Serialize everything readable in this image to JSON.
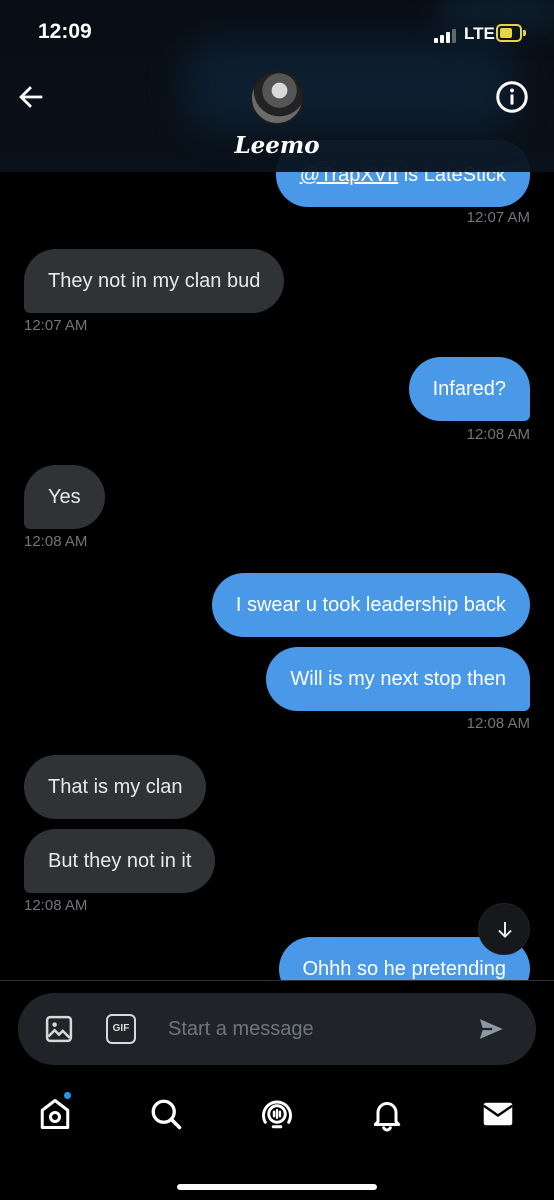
{
  "status_bar": {
    "time": "12:09",
    "network": "LTE"
  },
  "header": {
    "contact_name": "Leemo"
  },
  "messages": {
    "m0": {
      "mention": "@TrapXVII",
      "text": " is LateStick",
      "time": "12:07 AM"
    },
    "m1": {
      "text": "They not in my clan bud",
      "time": "12:07 AM"
    },
    "m2": {
      "text": "Infared?",
      "time": "12:08 AM"
    },
    "m3": {
      "text": "Yes",
      "time": "12:08 AM"
    },
    "m4": {
      "text": "I swear u took leadership back"
    },
    "m5": {
      "text": "Will is my next stop then",
      "time": "12:08 AM"
    },
    "m6": {
      "text": "That is my clan"
    },
    "m7": {
      "text": "But they not in it",
      "time": "12:08 AM"
    },
    "m8": {
      "text": "Ohhh so he pretending"
    }
  },
  "composer": {
    "placeholder": "Start a message",
    "gif_label": "GIF"
  },
  "icons": {
    "back": "arrow-left-icon",
    "info": "info-icon",
    "image": "image-icon",
    "send": "send-icon",
    "home": "home-icon",
    "search": "search-icon",
    "spaces": "spaces-icon",
    "notifications": "bell-icon",
    "messages": "mail-icon"
  },
  "colors": {
    "accent": "#1d9bf0",
    "outgoing_bubble": "#4a99e9",
    "incoming_bubble": "#2f3336"
  }
}
